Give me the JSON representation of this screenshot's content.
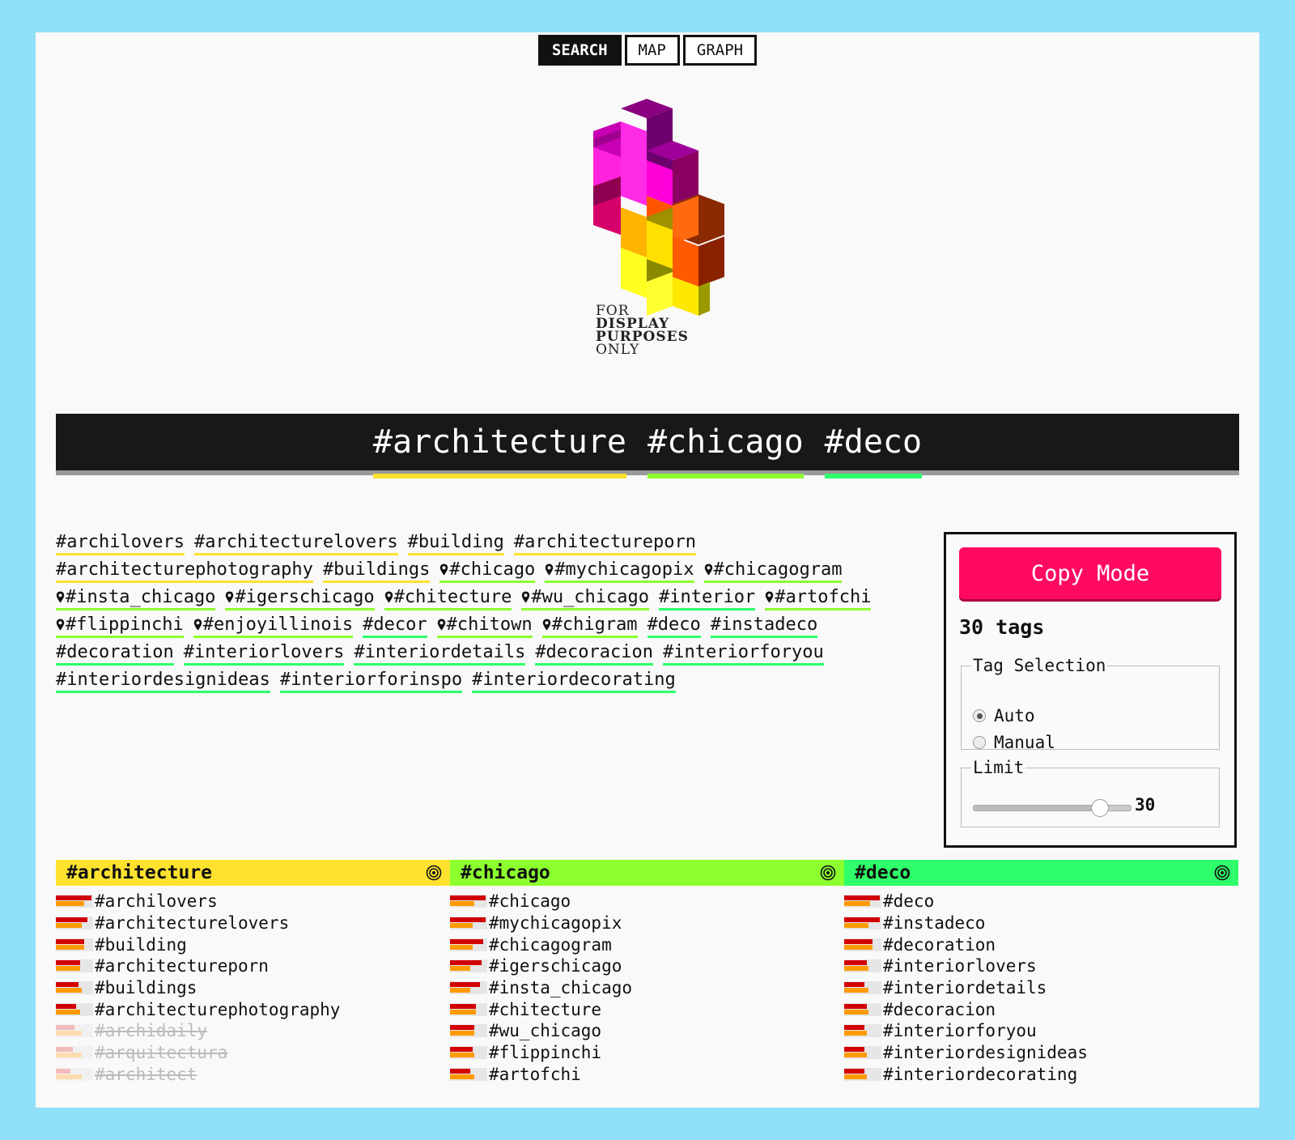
{
  "nav": {
    "items": [
      "SEARCH",
      "MAP",
      "GRAPH"
    ],
    "active": "SEARCH"
  },
  "logo": {
    "line1": "FOR",
    "line2": "DISPLAY",
    "line3": "PURPOSES",
    "line4": "ONLY"
  },
  "query": {
    "tags": [
      {
        "label": "#architecture",
        "color": "#ffe22e"
      },
      {
        "label": "#chicago",
        "color": "#8cff2e"
      },
      {
        "label": "#deco",
        "color": "#2eff6a"
      }
    ]
  },
  "cloud": [
    {
      "label": "#archilovers",
      "pin": false,
      "group": 0
    },
    {
      "label": "#architecturelovers",
      "pin": false,
      "group": 0
    },
    {
      "label": "#building",
      "pin": false,
      "group": 0
    },
    {
      "label": "#architectureporn",
      "pin": false,
      "group": 0
    },
    {
      "label": "#architecturephotography",
      "pin": false,
      "group": 0
    },
    {
      "label": "#buildings",
      "pin": false,
      "group": 0
    },
    {
      "label": "#chicago",
      "pin": true,
      "group": 1
    },
    {
      "label": "#mychicagopix",
      "pin": true,
      "group": 1
    },
    {
      "label": "#chicagogram",
      "pin": true,
      "group": 1
    },
    {
      "label": "#insta_chicago",
      "pin": true,
      "group": 1
    },
    {
      "label": "#igerschicago",
      "pin": true,
      "group": 1
    },
    {
      "label": "#chitecture",
      "pin": true,
      "group": 1
    },
    {
      "label": "#wu_chicago",
      "pin": true,
      "group": 1
    },
    {
      "label": "#interior",
      "pin": false,
      "group": 2
    },
    {
      "label": "#artofchi",
      "pin": true,
      "group": 1
    },
    {
      "label": "#flippinchi",
      "pin": true,
      "group": 1
    },
    {
      "label": "#enjoyillinois",
      "pin": true,
      "group": 1
    },
    {
      "label": "#decor",
      "pin": false,
      "group": 2
    },
    {
      "label": "#chitown",
      "pin": true,
      "group": 1
    },
    {
      "label": "#chigram",
      "pin": true,
      "group": 1
    },
    {
      "label": "#deco",
      "pin": false,
      "group": 2
    },
    {
      "label": "#instadeco",
      "pin": false,
      "group": 2
    },
    {
      "label": "#decoration",
      "pin": false,
      "group": 2
    },
    {
      "label": "#interiorlovers",
      "pin": false,
      "group": 2
    },
    {
      "label": "#interiordetails",
      "pin": false,
      "group": 2
    },
    {
      "label": "#decoracion",
      "pin": false,
      "group": 2
    },
    {
      "label": "#interiorforyou",
      "pin": false,
      "group": 2
    },
    {
      "label": "#interiordesignideas",
      "pin": false,
      "group": 2
    },
    {
      "label": "#interiorforinspo",
      "pin": false,
      "group": 2
    },
    {
      "label": "#interiordecorating",
      "pin": false,
      "group": 2
    }
  ],
  "panel": {
    "copy_label": "Copy Mode",
    "count_label": "30 tags",
    "selection_legend": "Tag Selection",
    "option_auto": "Auto",
    "option_manual": "Manual",
    "selected": "Auto",
    "limit_legend": "Limit",
    "limit_value": "30",
    "limit_fraction": 0.8
  },
  "columns": [
    {
      "title": "#architecture",
      "color": "#ffe22e",
      "items": [
        {
          "label": "#archilovers",
          "r": 0.95,
          "o": 0.75,
          "dim": false
        },
        {
          "label": "#architecturelovers",
          "r": 0.85,
          "o": 0.7,
          "dim": false
        },
        {
          "label": "#building",
          "r": 0.75,
          "o": 0.75,
          "dim": false
        },
        {
          "label": "#architectureporn",
          "r": 0.65,
          "o": 0.65,
          "dim": false
        },
        {
          "label": "#buildings",
          "r": 0.6,
          "o": 0.7,
          "dim": false
        },
        {
          "label": "#architecturephotography",
          "r": 0.55,
          "o": 0.65,
          "dim": false
        },
        {
          "label": "#archidaily",
          "r": 0.5,
          "o": 0.7,
          "dim": true
        },
        {
          "label": "#arquitectura",
          "r": 0.45,
          "o": 0.7,
          "dim": true
        },
        {
          "label": "#architect",
          "r": 0.4,
          "o": 0.7,
          "dim": true
        }
      ]
    },
    {
      "title": "#chicago",
      "color": "#8cff2e",
      "items": [
        {
          "label": "#chicago",
          "r": 0.95,
          "o": 0.65,
          "dim": false
        },
        {
          "label": "#mychicagopix",
          "r": 0.95,
          "o": 0.6,
          "dim": false
        },
        {
          "label": "#chicagogram",
          "r": 0.9,
          "o": 0.6,
          "dim": false
        },
        {
          "label": "#igerschicago",
          "r": 0.85,
          "o": 0.55,
          "dim": false
        },
        {
          "label": "#insta_chicago",
          "r": 0.8,
          "o": 0.55,
          "dim": false
        },
        {
          "label": "#chitecture",
          "r": 0.7,
          "o": 0.7,
          "dim": false
        },
        {
          "label": "#wu_chicago",
          "r": 0.65,
          "o": 0.65,
          "dim": false
        },
        {
          "label": "#flippinchi",
          "r": 0.6,
          "o": 0.65,
          "dim": false
        },
        {
          "label": "#artofchi",
          "r": 0.55,
          "o": 0.65,
          "dim": false
        }
      ]
    },
    {
      "title": "#deco",
      "color": "#2eff6a",
      "items": [
        {
          "label": "#deco",
          "r": 0.95,
          "o": 0.7,
          "dim": false
        },
        {
          "label": "#instadeco",
          "r": 0.95,
          "o": 0.65,
          "dim": false
        },
        {
          "label": "#decoration",
          "r": 0.75,
          "o": 0.75,
          "dim": false
        },
        {
          "label": "#interiorlovers",
          "r": 0.6,
          "o": 0.65,
          "dim": false
        },
        {
          "label": "#interiordetails",
          "r": 0.55,
          "o": 0.65,
          "dim": false
        },
        {
          "label": "#decoracion",
          "r": 0.6,
          "o": 0.65,
          "dim": false
        },
        {
          "label": "#interiorforyou",
          "r": 0.55,
          "o": 0.6,
          "dim": false
        },
        {
          "label": "#interiordesignideas",
          "r": 0.55,
          "o": 0.6,
          "dim": false
        },
        {
          "label": "#interiordecorating",
          "r": 0.55,
          "o": 0.6,
          "dim": false
        }
      ]
    }
  ]
}
